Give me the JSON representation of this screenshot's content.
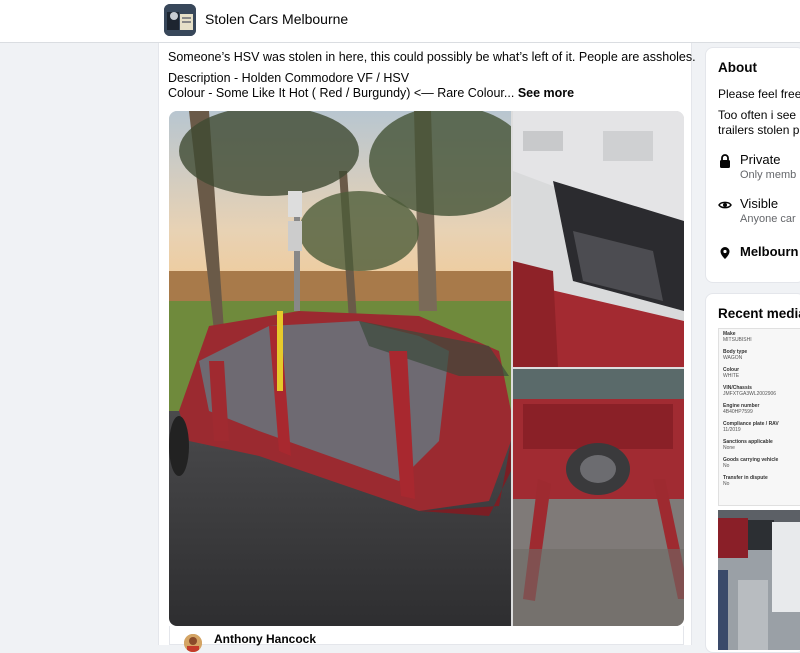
{
  "header": {
    "group_name": "Stolen Cars Melbourne"
  },
  "post": {
    "line1": "Someone’s HSV was stolen in here, this could possibly be what’s left of it. People are assholes.",
    "line2": "Description - Holden Commodore VF / HSV",
    "line3": "Colour - Some Like It Hot ( Red / Burgundy) <— Rare Colour...",
    "see_more": "See more",
    "commenter": "Anthony Hancock"
  },
  "sidebar": {
    "about": {
      "title": "About",
      "text1": "Please feel free",
      "text2": "Too often i see",
      "text3": "trailers stolen p",
      "private_label": "Private",
      "private_sub": "Only memb",
      "visible_label": "Visible",
      "visible_sub": "Anyone car",
      "location": "Melbourn"
    },
    "recent_media": {
      "title": "Recent media",
      "doc_lines": [
        [
          "Make",
          "MITSUBISHI"
        ],
        [
          "Body type",
          "WAGON"
        ],
        [
          "Colour",
          "WHITE"
        ],
        [
          "VIN/Chassis",
          "JMFXTGA3WL2002906"
        ],
        [
          "Engine number",
          "4B40HP7599"
        ],
        [
          "Compliance plate / RAV",
          "11/2019"
        ],
        [
          "Sanctions applicable",
          "None"
        ],
        [
          "Goods carrying vehicle",
          "No"
        ],
        [
          "Transfer in dispute",
          "No"
        ]
      ]
    }
  },
  "colors": {
    "accent": "#1877f2",
    "car_red": "#a0252b",
    "background": "#f0f2f5"
  }
}
